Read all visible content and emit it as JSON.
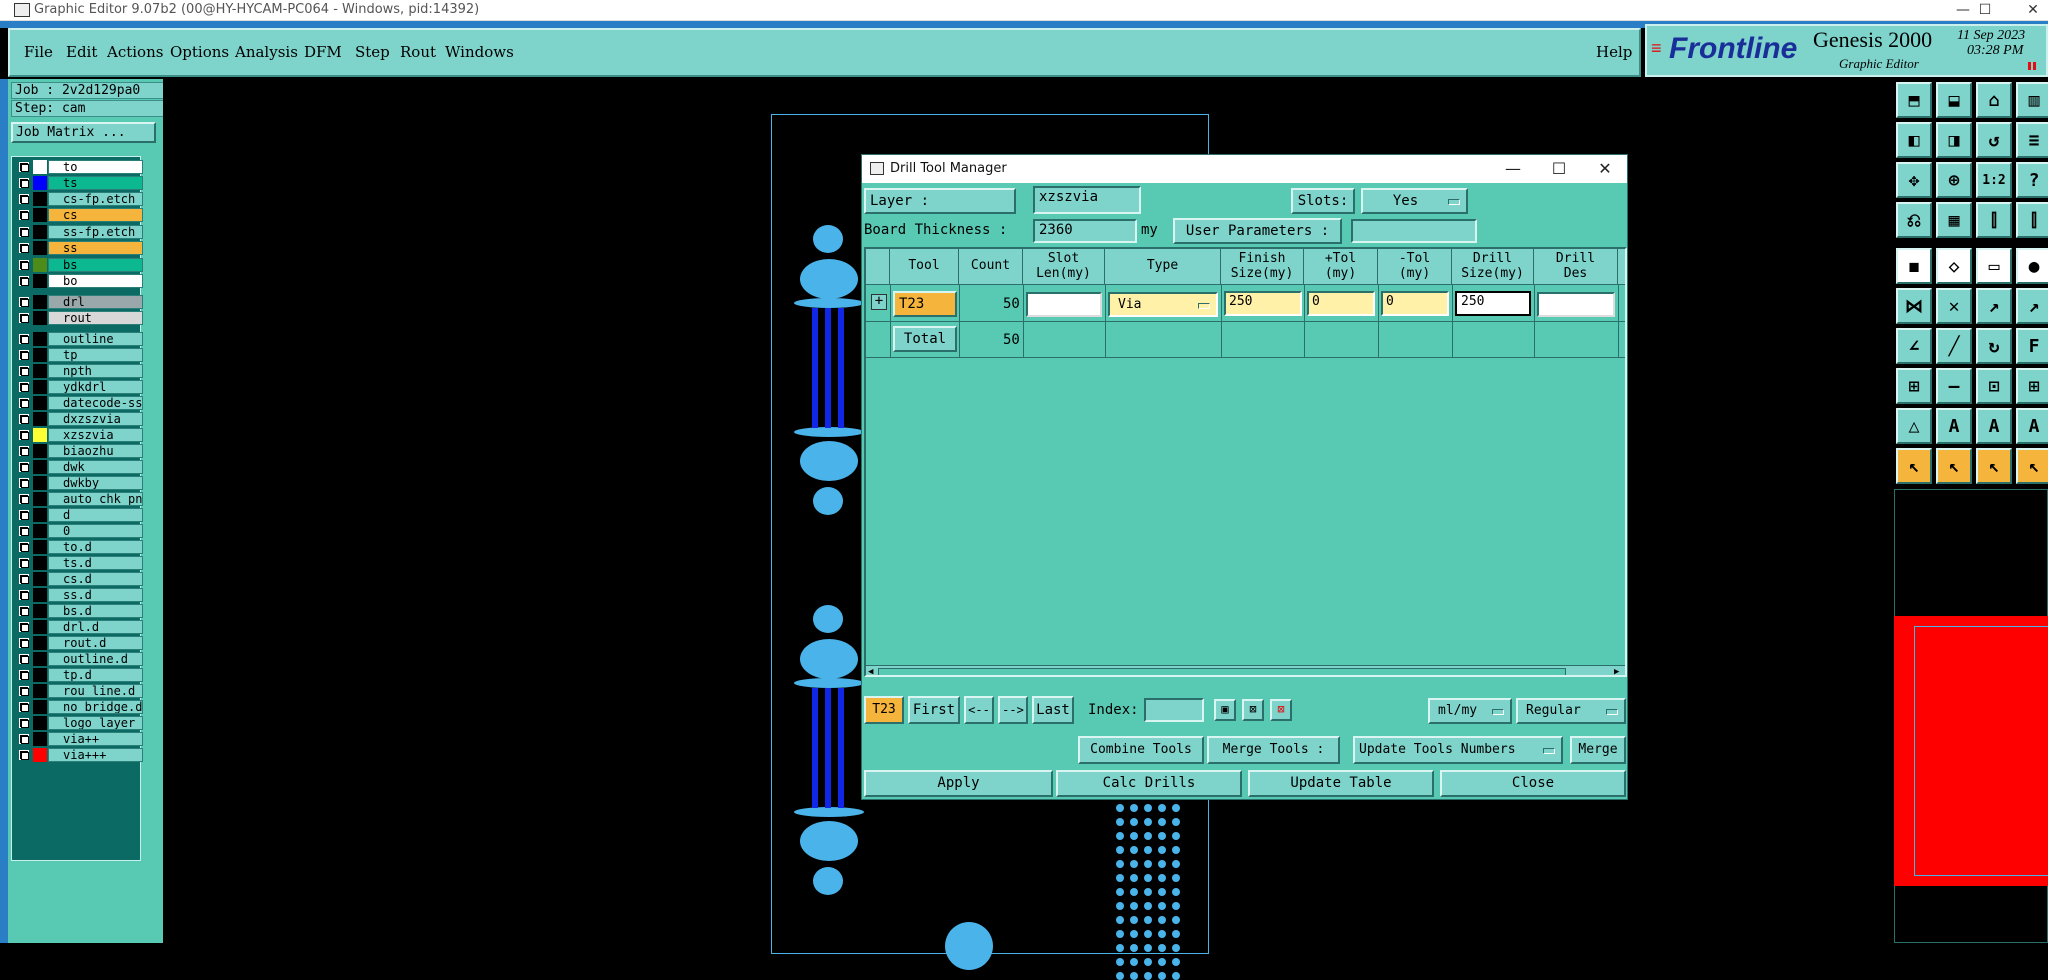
{
  "window": {
    "title": "Graphic Editor 9.07b2 (00@HY-HYCAM-PC064 - Windows, pid:14392)",
    "minimize": "—",
    "maximize": "☐",
    "close": "✕"
  },
  "menu": {
    "items": [
      "File",
      "Edit",
      "Actions",
      "Options",
      "Analysis",
      "DFM",
      "Step",
      "Rout",
      "Windows"
    ],
    "help": "Help"
  },
  "brand": {
    "logo": "Frontline",
    "product": "Genesis 2000",
    "subtitle": "Graphic Editor",
    "date": "11 Sep 2023",
    "time": "03:28 PM"
  },
  "left_panel": {
    "job": "Job : 2v2d129pa0",
    "step": "Step: cam",
    "job_matrix": "Job Matrix ...",
    "layers": [
      {
        "name": "to",
        "color": "#ffffff",
        "bg": "#ffffff"
      },
      {
        "name": "ts",
        "color": "#0000ff",
        "bg": "#0bb88f"
      },
      {
        "name": "cs-fp.etch",
        "color": "#000000",
        "bg": "#7ed3cb"
      },
      {
        "name": "cs",
        "color": "#000000",
        "bg": "#f5b43c"
      },
      {
        "name": "ss-fp.etch",
        "color": "#000000",
        "bg": "#7ed3cb"
      },
      {
        "name": "ss",
        "color": "#000000",
        "bg": "#f5b43c"
      },
      {
        "name": "bs",
        "color": "#4e8c1a",
        "bg": "#0bb88f"
      },
      {
        "name": "bo",
        "color": "#000000",
        "bg": "#ffffff"
      },
      {
        "name": "drl",
        "color": "#000000",
        "bg": "#9aa8ac"
      },
      {
        "name": "rout",
        "color": "#000000",
        "bg": "#d8d8d8"
      },
      {
        "name": "outline",
        "color": "#000000",
        "bg": "#7ed3cb"
      },
      {
        "name": "tp",
        "color": "#000000",
        "bg": "#7ed3cb"
      },
      {
        "name": "npth",
        "color": "#000000",
        "bg": "#7ed3cb"
      },
      {
        "name": "ydkdrl",
        "color": "#000000",
        "bg": "#7ed3cb"
      },
      {
        "name": "datecode-ss",
        "color": "#000000",
        "bg": "#7ed3cb"
      },
      {
        "name": "dxzszvia",
        "color": "#000000",
        "bg": "#7ed3cb"
      },
      {
        "name": "xzszvia",
        "color": "#ffff33",
        "bg": "#7ed3cb"
      },
      {
        "name": "biaozhu",
        "color": "#000000",
        "bg": "#7ed3cb"
      },
      {
        "name": "dwk",
        "color": "#000000",
        "bg": "#7ed3cb"
      },
      {
        "name": "dwkby",
        "color": "#000000",
        "bg": "#7ed3cb"
      },
      {
        "name": "auto_chk_pn_",
        "color": "#000000",
        "bg": "#7ed3cb"
      },
      {
        "name": "d",
        "color": "#000000",
        "bg": "#7ed3cb"
      },
      {
        "name": "0",
        "color": "#000000",
        "bg": "#7ed3cb"
      },
      {
        "name": "to.d",
        "color": "#000000",
        "bg": "#7ed3cb"
      },
      {
        "name": "ts.d",
        "color": "#000000",
        "bg": "#7ed3cb"
      },
      {
        "name": "cs.d",
        "color": "#000000",
        "bg": "#7ed3cb"
      },
      {
        "name": "ss.d",
        "color": "#000000",
        "bg": "#7ed3cb"
      },
      {
        "name": "bs.d",
        "color": "#000000",
        "bg": "#7ed3cb"
      },
      {
        "name": "drl.d",
        "color": "#000000",
        "bg": "#7ed3cb"
      },
      {
        "name": "rout.d",
        "color": "#000000",
        "bg": "#7ed3cb"
      },
      {
        "name": "outline.d",
        "color": "#000000",
        "bg": "#7ed3cb"
      },
      {
        "name": "tp.d",
        "color": "#000000",
        "bg": "#7ed3cb"
      },
      {
        "name": "rou_line.d",
        "color": "#000000",
        "bg": "#7ed3cb"
      },
      {
        "name": "no_bridge.d",
        "color": "#000000",
        "bg": "#7ed3cb"
      },
      {
        "name": "logo_layer_",
        "color": "#000000",
        "bg": "#7ed3cb"
      },
      {
        "name": "via++",
        "color": "#000000",
        "bg": "#7ed3cb"
      },
      {
        "name": "via+++",
        "color": "#ff0000",
        "bg": "#7ed3cb"
      }
    ]
  },
  "dialog": {
    "title": "Drill Tool Manager",
    "layer_label": "Layer          :",
    "layer_value": "xzszvia",
    "slots_label": "Slots:",
    "slots_value": "Yes",
    "board_thickness_label": "Board Thickness :",
    "board_thickness_value": "2360",
    "board_thickness_unit": "my",
    "user_params_label": "User Parameters :",
    "user_params_value": "",
    "columns": [
      "Tool",
      "Count",
      "Slot\nLen(my)",
      "Type",
      "Finish\nSize(my)",
      "+Tol\n(my)",
      "-Tol\n(my)",
      "Drill\nSize(my)",
      "Drill\nDes"
    ],
    "rows": [
      {
        "tool": "T23",
        "count": "50",
        "slot_len": "",
        "type": "Via",
        "finish_size": "250",
        "plus_tol": "0",
        "minus_tol": "0",
        "drill_size": "250",
        "drill_des": ""
      }
    ],
    "total_label": "Total",
    "total_count": "50",
    "nav": {
      "current_tool": "T23",
      "first": "First",
      "prev": "<--",
      "next": "-->",
      "last": "Last",
      "index_label": "Index:",
      "index_value": "",
      "units": "ml/my",
      "mode": "Regular"
    },
    "actions": {
      "combine": "Combine Tools",
      "merge_label": "Merge Tools :",
      "update_numbers": "Update Tools Numbers",
      "merge": "Merge"
    },
    "footer": {
      "apply": "Apply",
      "calc": "Calc Drills",
      "update": "Update Table",
      "close": "Close"
    }
  }
}
